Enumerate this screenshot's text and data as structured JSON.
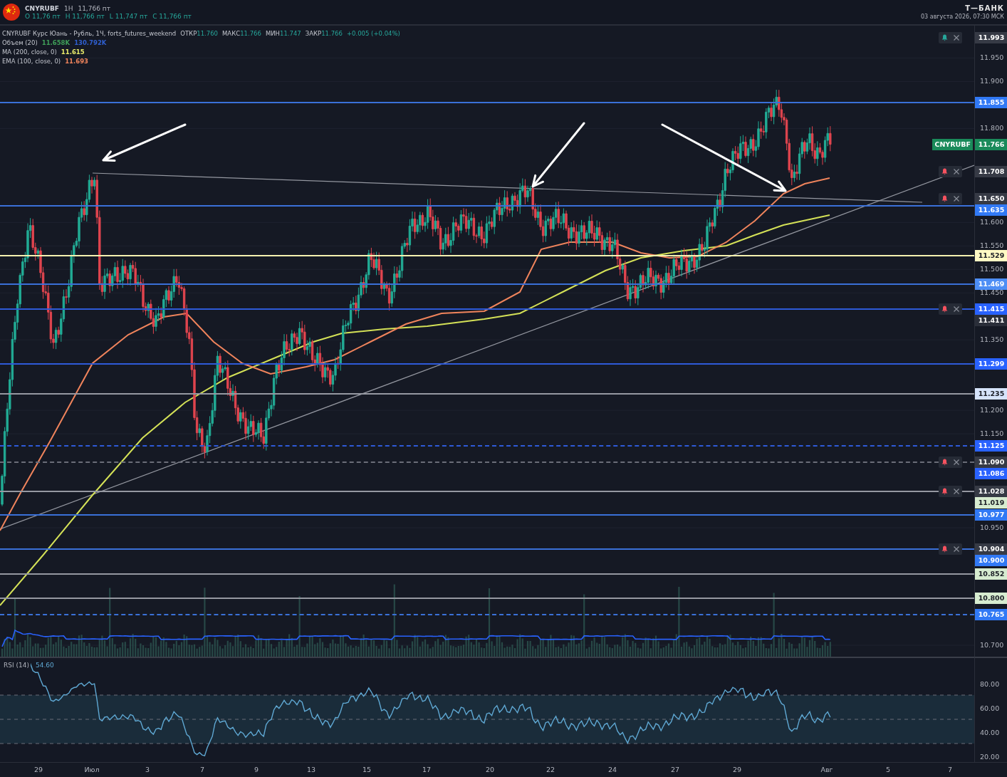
{
  "header": {
    "symbol": "CNYRUBF",
    "interval": "1H",
    "price": "11,766 пт",
    "ohlc": [
      {
        "key": "O",
        "value": "11,76 пт"
      },
      {
        "key": "H",
        "value": "11,766 пт"
      },
      {
        "key": "L",
        "value": "11,747 пт"
      },
      {
        "key": "C",
        "value": "11,766 пт"
      }
    ],
    "brand": "Т—БАНК",
    "datetime": "03 августа 2026, 07:30 МСК"
  },
  "legend": {
    "title": "CNYRUBF Курс Юань - Рубль, 1Ч, forts_futures_weekend",
    "fields": [
      {
        "key": "ОТКР",
        "value": "11.760"
      },
      {
        "key": "МАКС",
        "value": "11.766"
      },
      {
        "key": "МИН",
        "value": "11.747"
      },
      {
        "key": "ЗАКР",
        "value": "11.766"
      }
    ],
    "change": "+0.005 (+0.04%)",
    "indicators": [
      {
        "name": "Объем (20)",
        "values": [
          {
            "text": "11.658K",
            "color": "#3f9f59"
          },
          {
            "text": "130.792K",
            "color": "#2f5fd0"
          }
        ]
      },
      {
        "name": "MA (200, close, 0)",
        "values": [
          {
            "text": "11.615",
            "color": "#e8ea6a"
          }
        ]
      },
      {
        "name": "EMA (100, close, 0)",
        "values": [
          {
            "text": "11.693",
            "color": "#f0845c"
          }
        ]
      }
    ]
  },
  "price_axis": {
    "ticks": [
      "11.950",
      "11.900",
      "11.800",
      "11.600",
      "11.550",
      "11.500",
      "11.450",
      "11.350",
      "11.200",
      "11.150",
      "10.950",
      "10.700"
    ]
  },
  "current_price": {
    "symbol": "CNYRUBF",
    "label": "11.766"
  },
  "levels": [
    {
      "label": "11.993",
      "color": "#363a45",
      "alert": {
        "color": "#26a69a"
      }
    },
    {
      "label": "11.855",
      "color": "#3179f5",
      "line": {
        "kind": "solid",
        "color": "#3a70d8"
      }
    },
    {
      "label": "11.708",
      "color": "#363a45",
      "alert": {
        "color": "#f7525f"
      }
    },
    {
      "label": "11.650",
      "color": "#363a45",
      "alert": {
        "color": "#f7525f"
      }
    },
    {
      "label": "11.635",
      "color": "#3179f5",
      "line": {
        "kind": "solid",
        "color": "#3a70d8"
      }
    },
    {
      "label": "11.529",
      "color": "#fff9c4",
      "line": {
        "kind": "solid",
        "color": "#f4f1b0"
      }
    },
    {
      "label": "11.469",
      "color": "#4d8ef5",
      "line": {
        "kind": "solid",
        "color": "#3a70d8"
      }
    },
    {
      "label": "11.415",
      "color": "#2962ff",
      "line": {
        "kind": "solid",
        "color": "#2e5ad8"
      },
      "alert": {
        "color": "#f7525f"
      }
    },
    {
      "label": "11.411",
      "color": "#2a2e39"
    },
    {
      "label": "11.299",
      "color": "#2962ff",
      "line": {
        "kind": "solid",
        "color": "#2e5ad8"
      }
    },
    {
      "label": "11.235",
      "color": "#d6e4fb",
      "line": {
        "kind": "solid",
        "color": "#9598a1"
      }
    },
    {
      "label": "11.125",
      "color": "#2962ff",
      "line": {
        "kind": "dashed",
        "color": "#2e5ad8"
      }
    },
    {
      "label": "11.090",
      "color": "#363a45",
      "line": {
        "kind": "dashed",
        "color": "#6a6d78"
      },
      "alert": {
        "color": "#f7525f"
      }
    },
    {
      "label": "11.086",
      "color": "#2962ff"
    },
    {
      "label": "11.028",
      "color": "#363a45",
      "line": {
        "kind": "solid",
        "color": "#9598a1"
      },
      "alert": {
        "color": "#f7525f"
      }
    },
    {
      "label": "11.019",
      "color": "#d7ecd0"
    },
    {
      "label": "10.977",
      "color": "#3179f5",
      "line": {
        "kind": "solid",
        "color": "#3a70d8"
      }
    },
    {
      "label": "10.904",
      "color": "#363a45",
      "line": {
        "kind": "solid",
        "color": "#3a70d8"
      },
      "alert": {
        "color": "#f7525f"
      }
    },
    {
      "label": "10.900",
      "color": "#3179f5"
    },
    {
      "label": "10.852",
      "color": "#d7ecd0",
      "line": {
        "kind": "solid",
        "color": "#9598a1"
      }
    },
    {
      "label": "10.800",
      "color": "#d7ecd0",
      "line": {
        "kind": "solid",
        "color": "#9598a1"
      }
    },
    {
      "label": "10.765",
      "color": "#3179f5",
      "line": {
        "kind": "dashed",
        "color": "#3a70d8"
      }
    }
  ],
  "rsi": {
    "name": "RSI (14)",
    "value": "54.60",
    "ticks": [
      "80.00",
      "60.00",
      "40.00",
      "20.00"
    ]
  },
  "time_axis": {
    "labels": [
      "29",
      "Июл",
      "3",
      "7",
      "9",
      "13",
      "15",
      "17",
      "20",
      "22",
      "24",
      "27",
      "29",
      "Авг",
      "5",
      "7"
    ]
  }
}
